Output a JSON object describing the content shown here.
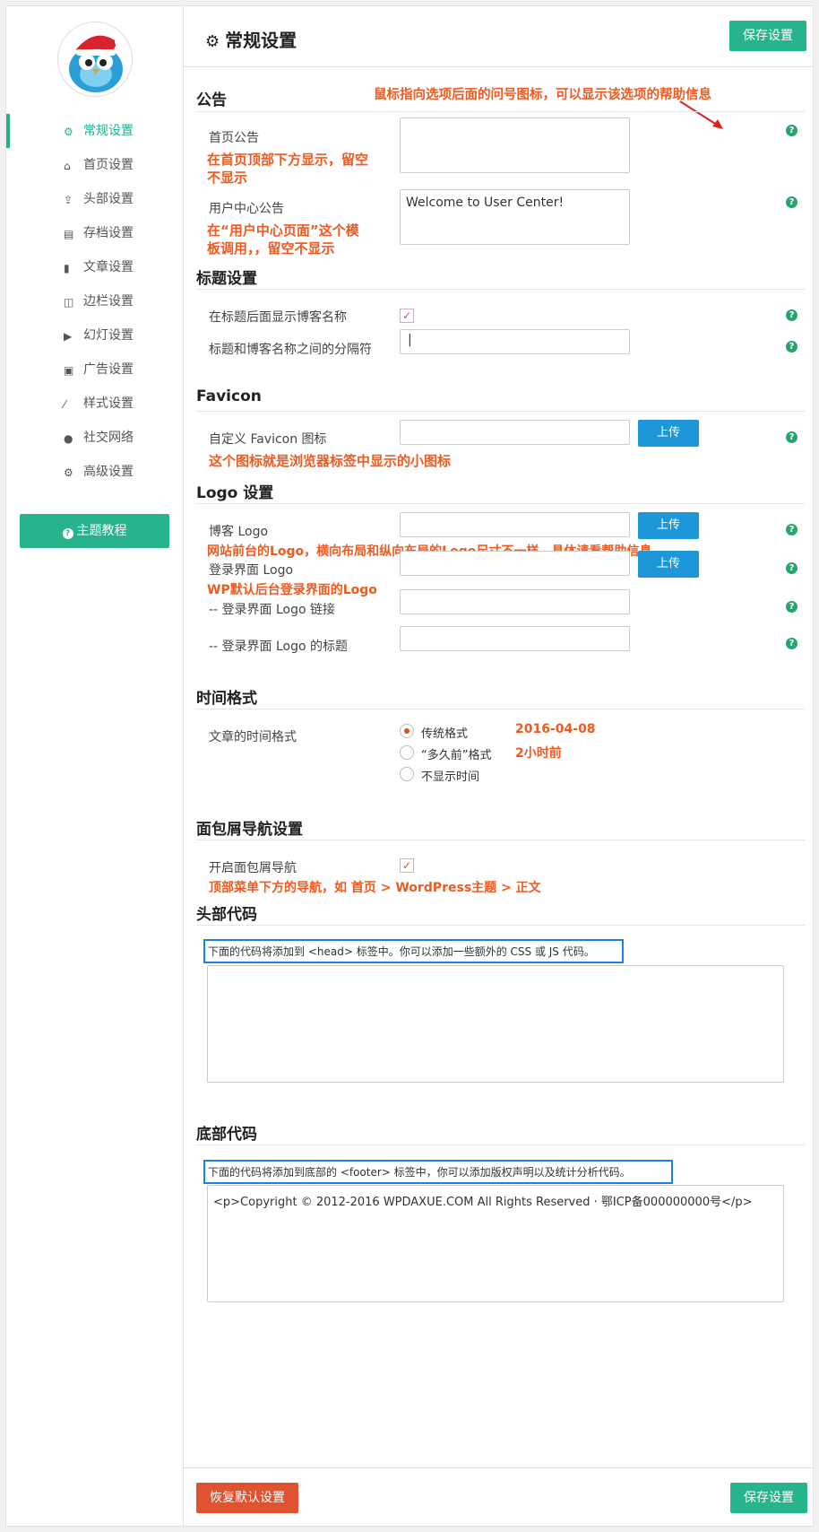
{
  "sidebar": {
    "nav": [
      {
        "label": "常规设置",
        "icon": "gear-icon"
      },
      {
        "label": "首页设置",
        "icon": "home-icon"
      },
      {
        "label": "头部设置",
        "icon": "upload-icon"
      },
      {
        "label": "存档设置",
        "icon": "book-icon"
      },
      {
        "label": "文章设置",
        "icon": "file-icon"
      },
      {
        "label": "边栏设置",
        "icon": "columns-icon"
      },
      {
        "label": "幻灯设置",
        "icon": "play-circle-icon"
      },
      {
        "label": "广告设置",
        "icon": "gift-icon"
      },
      {
        "label": "样式设置",
        "icon": "magic-wand-icon"
      },
      {
        "label": "社交网络",
        "icon": "globe-icon"
      },
      {
        "label": "高级设置",
        "icon": "cogs-icon"
      }
    ],
    "tutorial_button": "主题教程"
  },
  "header": {
    "title": "常规设置",
    "save_label": "保存设置"
  },
  "annotations": {
    "help_tip": "鼠标指向选项后面的问号图标，可以显示该选项的帮助信息",
    "homepage_notice": "在首页顶部下方显示，留空不显示",
    "user_center_notice": "在“用户中心页面”这个模板调用，，留空不显示",
    "favicon": "这个图标就是浏览器标签中显示的小图标",
    "blog_logo": "网站前台的Logo，横向布局和纵向布局的Logo尺寸不一样，具体请看帮助信息",
    "login_logo": "WP默认后台登录界面的Logo",
    "time_traditional": "2016-04-08",
    "time_ago": "2小时前",
    "breadcrumb": "顶部菜单下方的导航，如 首页 > WordPress主题 > 正文"
  },
  "sections": {
    "notice": {
      "title": "公告",
      "homepage_label": "首页公告",
      "homepage_value": "",
      "user_center_label": "用户中心公告",
      "user_center_value": "Welcome to User Center!"
    },
    "title_settings": {
      "title": "标题设置",
      "show_blogname_label": "在标题后面显示博客名称",
      "show_blogname_checked": true,
      "separator_label": "标题和博客名称之间的分隔符",
      "separator_value": "|"
    },
    "favicon": {
      "title": "Favicon",
      "label": "自定义 Favicon 图标",
      "upload_label": "上传"
    },
    "logo": {
      "title": "Logo 设置",
      "blog_logo_label": "博客 Logo",
      "login_logo_label": "登录界面 Logo",
      "login_logo_link_label": "-- 登录界面 Logo 链接",
      "login_logo_title_label": "-- 登录界面 Logo 的标题",
      "upload_label": "上传"
    },
    "time_format": {
      "title": "时间格式",
      "label": "文章的时间格式",
      "options": [
        "传统格式",
        "“多久前”格式",
        "不显示时间"
      ],
      "selected": "传统格式"
    },
    "breadcrumb": {
      "title": "面包屑导航设置",
      "label": "开启面包屑导航",
      "checked": true
    },
    "head_code": {
      "title": "头部代码",
      "desc": "下面的代码将添加到 <head> 标签中。你可以添加一些额外的 CSS 或 JS 代码。",
      "value": ""
    },
    "footer_code": {
      "title": "底部代码",
      "desc": "下面的代码将添加到底部的 <footer> 标签中，你可以添加版权声明以及统计分析代码。",
      "value": "<p>Copyright © 2012-2016 WPDAXUE.COM All Rights Reserved · 鄂ICP备000000000号</p>"
    }
  },
  "footer": {
    "reset_label": "恢复默认设置",
    "save_label": "保存设置"
  },
  "colors": {
    "accent": "#27b48c",
    "upload": "#1e97d8",
    "reset": "#e05230",
    "annotation": "#f05a20",
    "note_border": "#1e7fe6"
  }
}
